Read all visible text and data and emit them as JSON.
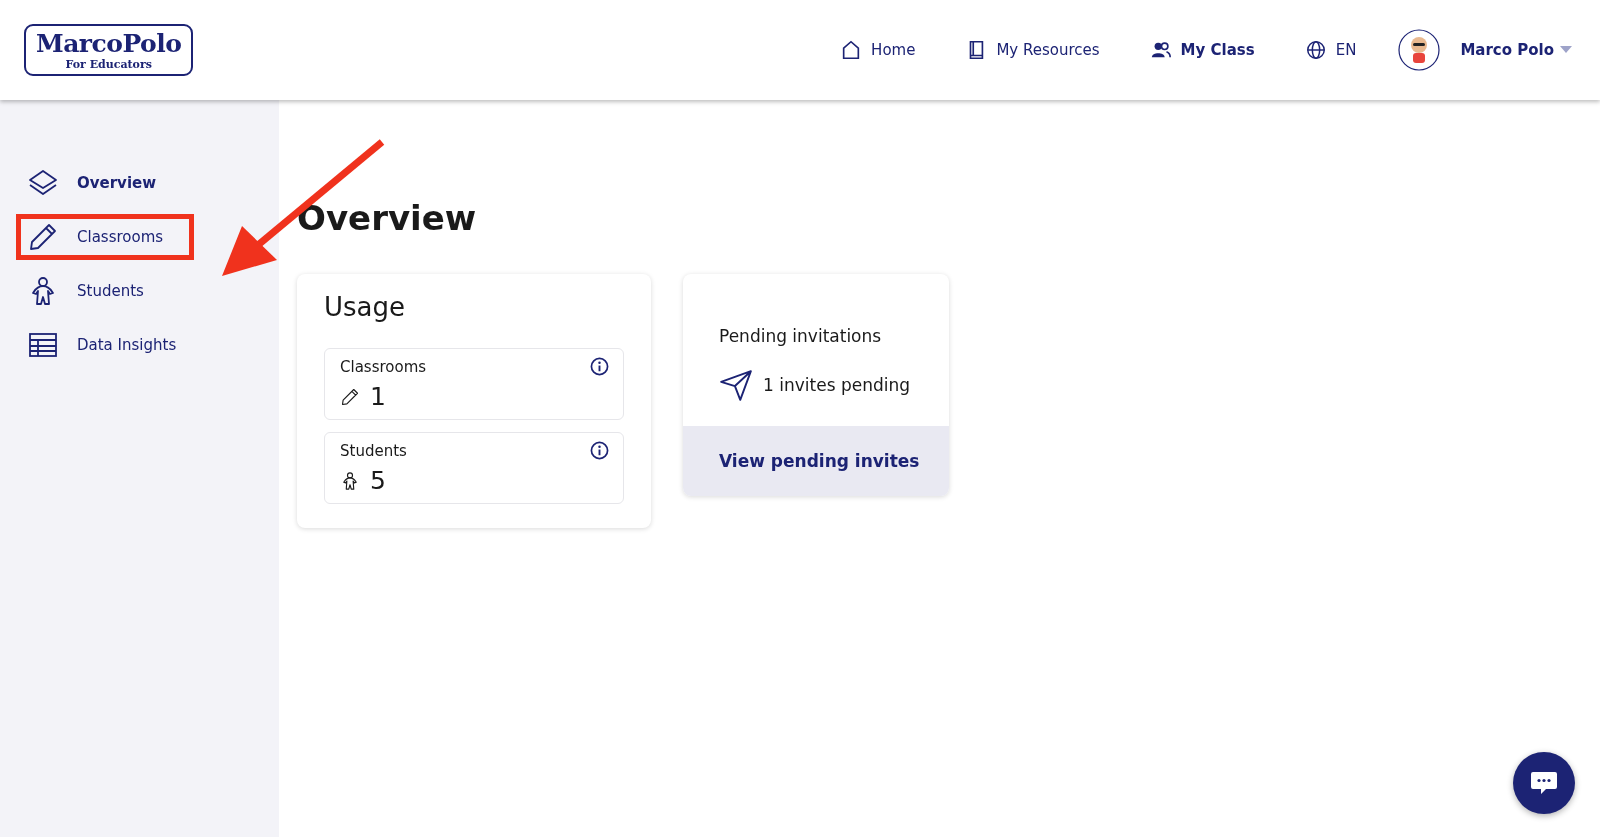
{
  "logo": {
    "title": "MarcoPolo",
    "subtitle": "For Educators"
  },
  "nav": [
    {
      "kind": "home",
      "label": "Home",
      "selected": false
    },
    {
      "kind": "book",
      "label": "My Resources",
      "selected": false
    },
    {
      "kind": "people",
      "label": "My Class",
      "selected": true
    },
    {
      "kind": "globe",
      "label": "EN",
      "selected": false
    }
  ],
  "user": {
    "name": "Marco Polo"
  },
  "sidebar": {
    "items": [
      {
        "kind": "layers",
        "label": "Overview",
        "selected": true,
        "highlighted": false
      },
      {
        "kind": "pencil",
        "label": "Classrooms",
        "selected": false,
        "highlighted": true
      },
      {
        "kind": "person",
        "label": "Students",
        "selected": false,
        "highlighted": false
      },
      {
        "kind": "table",
        "label": "Data Insights",
        "selected": false,
        "highlighted": false
      }
    ]
  },
  "annotation_arrow": true,
  "page": {
    "title": "Overview"
  },
  "usage": {
    "title": "Usage",
    "stats": [
      {
        "kind": "pencil",
        "label": "Classrooms",
        "value": "1"
      },
      {
        "kind": "person",
        "label": "Students",
        "value": "5"
      }
    ]
  },
  "invitations": {
    "title": "Pending invitations",
    "count_text": "1 invites pending",
    "link": "View pending invites"
  }
}
